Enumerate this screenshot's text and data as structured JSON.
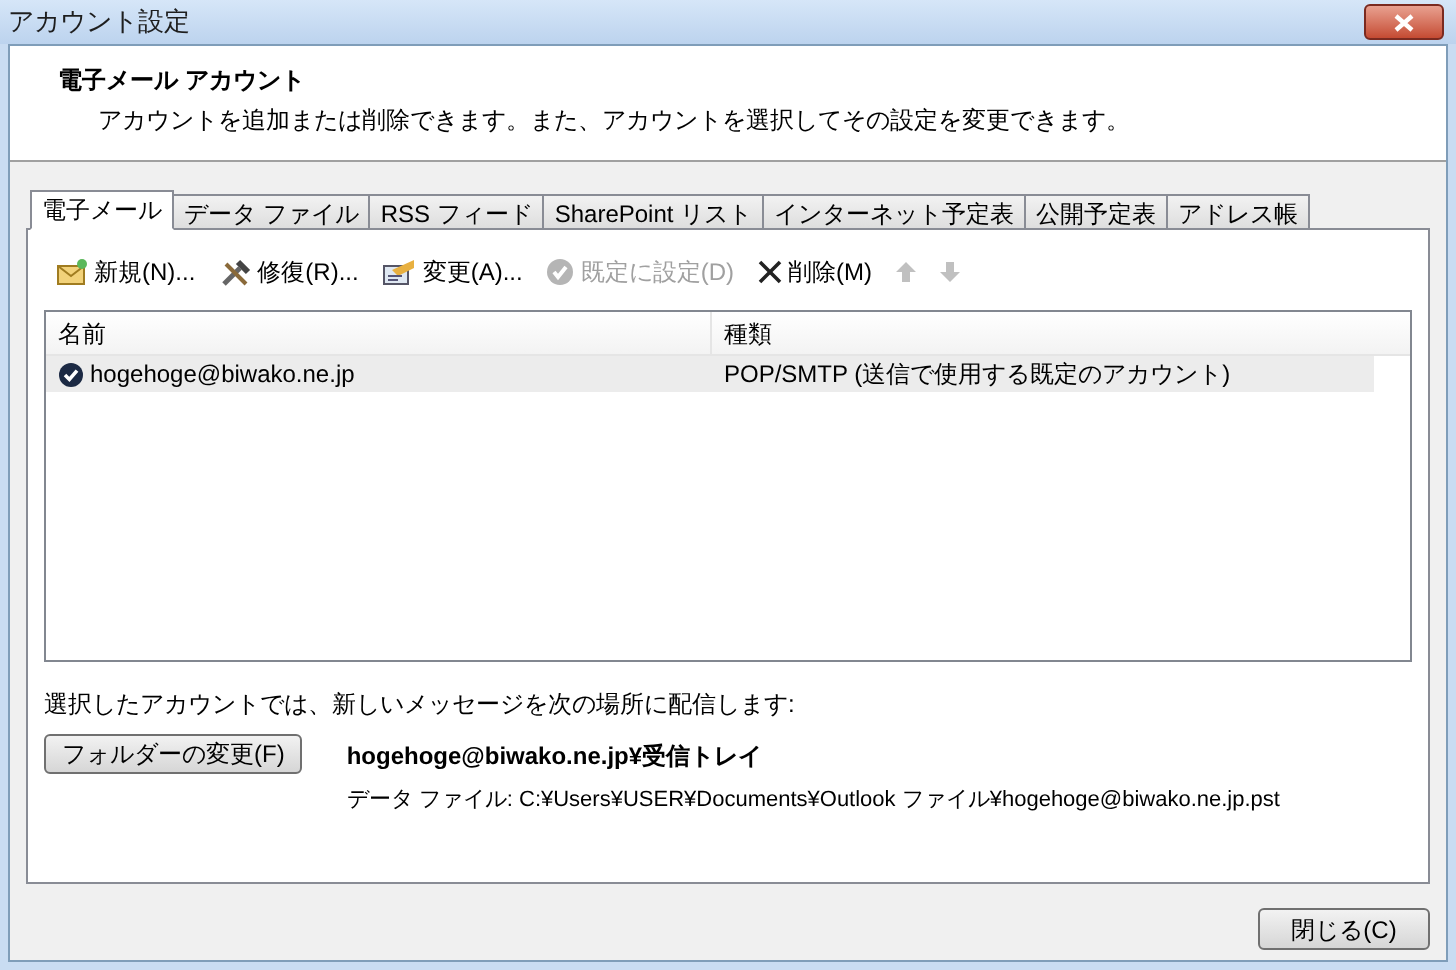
{
  "window": {
    "title": "アカウント設定"
  },
  "header": {
    "title": "電子メール アカウント",
    "description": "アカウントを追加または削除できます。また、アカウントを選択してその設定を変更できます。"
  },
  "tabs": [
    {
      "label": "電子メール",
      "selected": true
    },
    {
      "label": "データ ファイル",
      "selected": false
    },
    {
      "label": "RSS フィード",
      "selected": false
    },
    {
      "label": "SharePoint リスト",
      "selected": false
    },
    {
      "label": "インターネット予定表",
      "selected": false
    },
    {
      "label": "公開予定表",
      "selected": false
    },
    {
      "label": "アドレス帳",
      "selected": false
    }
  ],
  "toolbar": [
    {
      "kind": "new",
      "label": "新規(N)...",
      "disabled": false
    },
    {
      "kind": "repair",
      "label": "修復(R)...",
      "disabled": false
    },
    {
      "kind": "change",
      "label": "変更(A)...",
      "disabled": false
    },
    {
      "kind": "default",
      "label": "既定に設定(D)",
      "disabled": true
    },
    {
      "kind": "delete",
      "label": "削除(M)",
      "disabled": false
    },
    {
      "kind": "up",
      "disabled": true
    },
    {
      "kind": "down",
      "disabled": true
    }
  ],
  "table": {
    "columns": [
      "名前",
      "種類"
    ],
    "rows": [
      {
        "name": "hogehoge@biwako.ne.jp",
        "type": "POP/SMTP (送信で使用する既定のアカウント)",
        "default": true,
        "selected": true
      }
    ]
  },
  "delivery": {
    "label": "選択したアカウントでは、新しいメッセージを次の場所に配信します:",
    "button": "フォルダーの変更(F)",
    "folder": "hogehoge@biwako.ne.jp¥受信トレイ",
    "data_file": "データ ファイル: C:¥Users¥USER¥Documents¥Outlook ファイル¥hogehoge@biwako.ne.jp.pst"
  },
  "close_button": "閉じる(C)"
}
